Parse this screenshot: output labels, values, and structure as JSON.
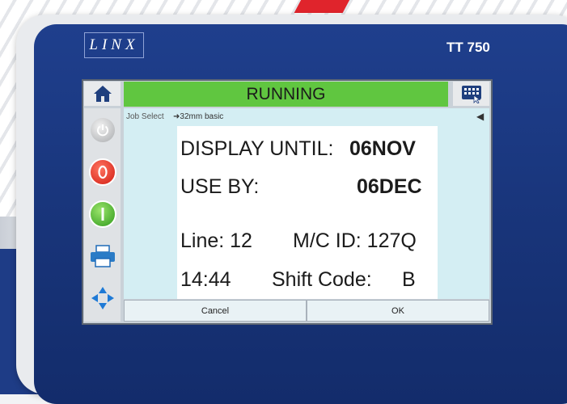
{
  "device": {
    "brand": "LINX",
    "model": "TT 750"
  },
  "screen": {
    "status": "RUNNING",
    "status_color": "#60c640",
    "job_select_label": "Job Select",
    "job_name": "➜32mm basic",
    "back_arrow": "◀",
    "label_preview": {
      "display_until_label": "DISPLAY UNTIL:",
      "display_until_value": "06NOV",
      "use_by_label": "USE BY:",
      "use_by_value": "06DEC",
      "line": "Line: 12",
      "mc_id": "M/C ID: 127Q",
      "time": "14:44",
      "shift_code_label": "Shift Code:",
      "shift_code_value": "B"
    },
    "buttons": {
      "cancel": "Cancel",
      "ok": "OK"
    },
    "icons": [
      "home-icon",
      "keyboard-icon",
      "power-icon",
      "stop-icon",
      "start-icon",
      "printer-icon",
      "navigate-icon"
    ]
  }
}
